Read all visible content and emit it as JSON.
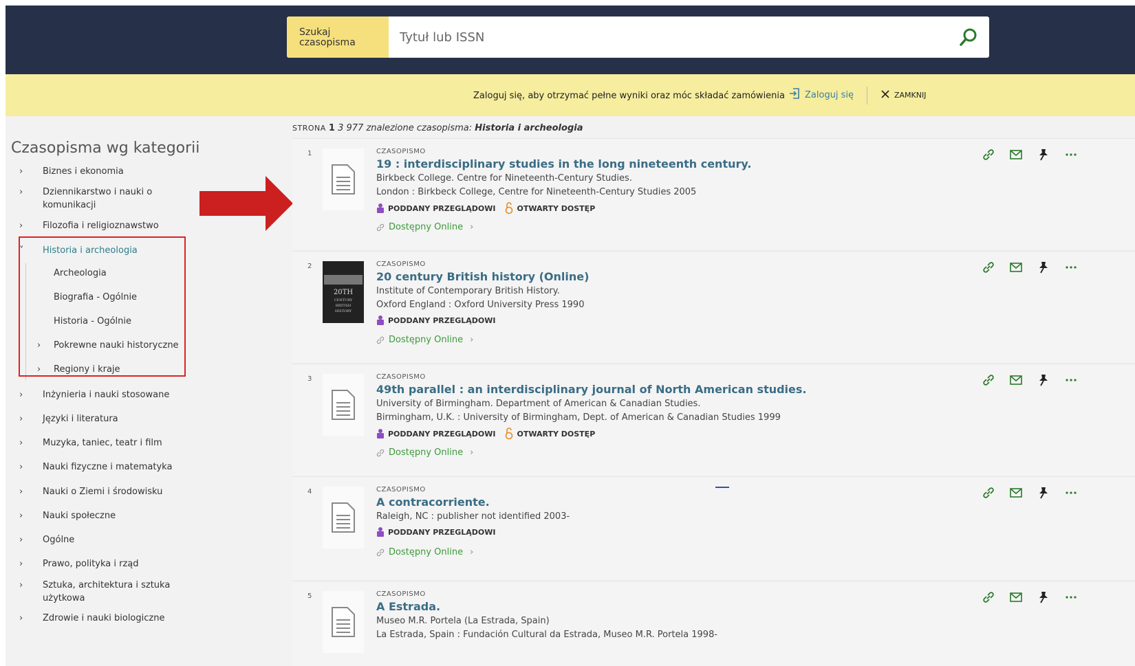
{
  "search": {
    "label": "Szukaj czasopisma",
    "placeholder": "Tytuł lub ISSN"
  },
  "banner": {
    "message": "Zaloguj się, aby otrzymać pełne wyniki oraz móc składać zamówienia",
    "login_label": "Zaloguj się",
    "close_label": "ZAMKNIJ"
  },
  "sidebar": {
    "title": "Czasopisma wg kategorii",
    "categories": [
      {
        "label": "Biznes i ekonomia"
      },
      {
        "label": "Dziennikarstwo i nauki o komunikacji"
      },
      {
        "label": "Filozofia i religioznawstwo"
      },
      {
        "label": "Historia i archeologia"
      },
      {
        "label": "Inżynieria i nauki stosowane"
      },
      {
        "label": "Języki i literatura"
      },
      {
        "label": "Muzyka, taniec, teatr i film"
      },
      {
        "label": "Nauki fizyczne i matematyka"
      },
      {
        "label": "Nauki o Ziemi i środowisku"
      },
      {
        "label": "Nauki społeczne"
      },
      {
        "label": "Ogólne"
      },
      {
        "label": "Prawo, polityka i rząd"
      },
      {
        "label": "Sztuka, architektura i sztuka użytkowa"
      },
      {
        "label": "Zdrowie i nauki biologiczne"
      }
    ],
    "subcategories": [
      {
        "label": "Archeologia"
      },
      {
        "label": "Biografia - Ogólnie"
      },
      {
        "label": "Historia - Ogólnie"
      },
      {
        "label": "Pokrewne nauki historyczne"
      },
      {
        "label": "Regiony i kraje"
      }
    ]
  },
  "results": {
    "page_label": "STRONA",
    "page_number": "1",
    "count_text": "3 977 znalezione czasopisma:",
    "category": "Historia i archeologia",
    "type_label": "CZASOPISMO",
    "peer_label": "PODDANY PRZEGLĄDOWI",
    "open_label": "OTWARTY DOSTĘP",
    "online_label": "Dostępny Online",
    "items": [
      {
        "num": "1",
        "title": "19 : interdisciplinary studies in the long nineteenth century.",
        "line1": "Birkbeck College. Centre for Nineteenth-Century Studies.",
        "line2": "London : Birkbeck College, Centre for Nineteenth-Century Studies 2005"
      },
      {
        "num": "2",
        "title": "20 century British history (Online)",
        "line1": "Institute of Contemporary British History.",
        "line2": "Oxford England : Oxford University Press 1990",
        "thumb_text": "20TH CENTURY BRITISH HISTORY"
      },
      {
        "num": "3",
        "title": "49th parallel : an interdisciplinary journal of North American studies.",
        "line1": "University of Birmingham. Department of American & Canadian Studies.",
        "line2": "Birmingham, U.K. : University of Birmingham, Dept. of American & Canadian Studies 1999"
      },
      {
        "num": "4",
        "title": "A contracorriente.",
        "line1": "Raleigh, NC : publisher not identified 2003-"
      },
      {
        "num": "5",
        "title": "A Estrada.",
        "line1": "Museo M.R. Portela (La Estrada, Spain)",
        "line2": "La Estrada, Spain : Fundación Cultural da Estrada, Museo M.R. Portela 1998-"
      }
    ]
  },
  "colors": {
    "header_bg": "#263149",
    "banner_bg": "#f6ed9e",
    "search_label_bg": "#f6e07d",
    "link": "#3a6d85",
    "active_category": "#2f7d8a",
    "online": "#3a9a3a",
    "highlight": "#dd2222"
  }
}
